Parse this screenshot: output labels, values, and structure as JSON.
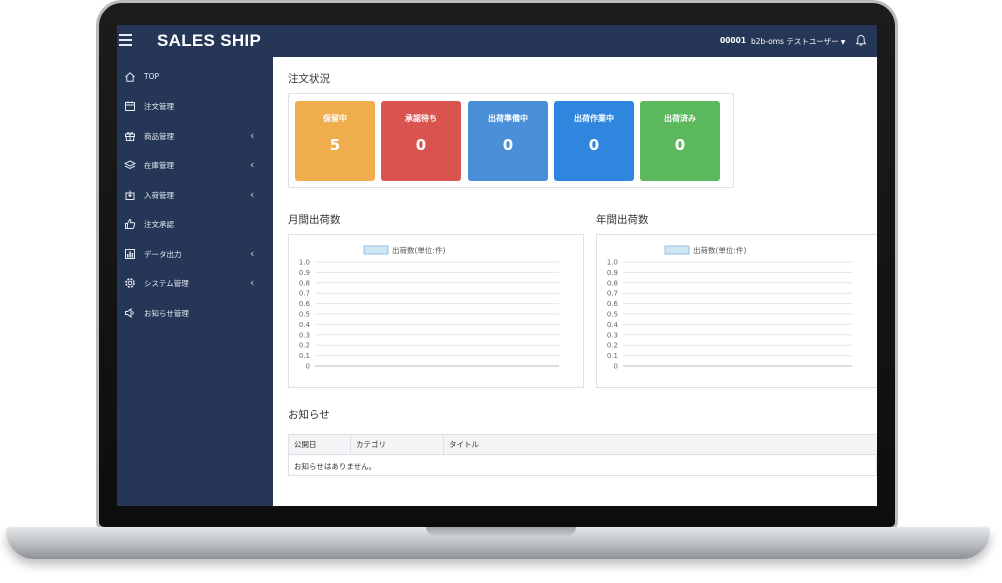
{
  "app": {
    "title": "SALES SHIP"
  },
  "header": {
    "user_code": "00001",
    "user_name": "b2b-oms テストユーザー",
    "icons": [
      "hamburger-menu-icon",
      "bell-icon"
    ]
  },
  "sidebar": {
    "items": [
      {
        "label": "TOP",
        "icon": "home-icon",
        "expandable": false
      },
      {
        "label": "注文管理",
        "icon": "calendar-icon",
        "expandable": false
      },
      {
        "label": "商品管理",
        "icon": "gift-icon",
        "expandable": true
      },
      {
        "label": "在庫管理",
        "icon": "layers-icon",
        "expandable": true
      },
      {
        "label": "入荷管理",
        "icon": "download-box-icon",
        "expandable": true
      },
      {
        "label": "注文承認",
        "icon": "thumbs-up-icon",
        "expandable": false
      },
      {
        "label": "データ出力",
        "icon": "bar-chart-icon",
        "expandable": true
      },
      {
        "label": "システム管理",
        "icon": "gear-icon",
        "expandable": true
      },
      {
        "label": "お知らせ管理",
        "icon": "megaphone-icon",
        "expandable": false
      }
    ]
  },
  "order_status": {
    "title": "注文状況",
    "cards": [
      {
        "label": "保留中",
        "count": "5",
        "color": "#f0ad4e"
      },
      {
        "label": "承認待ち",
        "count": "0",
        "color": "#d9534f"
      },
      {
        "label": "出荷準備中",
        "count": "0",
        "color": "#4a90d9"
      },
      {
        "label": "出荷作業中",
        "count": "0",
        "color": "#2e86de"
      },
      {
        "label": "出荷済み",
        "count": "0",
        "color": "#5cb85c"
      }
    ]
  },
  "charts_titles": {
    "monthly": "月間出荷数",
    "yearly": "年間出荷数"
  },
  "chart_data": [
    {
      "type": "bar",
      "title": "",
      "legend": "出荷数(単位:件)",
      "legend_position": "top-center",
      "yticks": [
        "1.0",
        "0.9",
        "0.8",
        "0.7",
        "0.6",
        "0.5",
        "0.4",
        "0.3",
        "0.2",
        "0.1",
        "0"
      ],
      "ylim": [
        0,
        1.0
      ],
      "grid": true,
      "categories": [],
      "series": [
        {
          "name": "出荷数(単位:件)",
          "values": []
        }
      ]
    },
    {
      "type": "bar",
      "title": "",
      "legend": "出荷数(単位:件)",
      "legend_position": "top-center",
      "yticks": [
        "1.0",
        "0.9",
        "0.8",
        "0.7",
        "0.6",
        "0.5",
        "0.4",
        "0.3",
        "0.2",
        "0.1",
        "0"
      ],
      "ylim": [
        0,
        1.0
      ],
      "grid": true,
      "categories": [],
      "series": [
        {
          "name": "出荷数(単位:件)",
          "values": []
        }
      ]
    }
  ],
  "notices": {
    "title": "お知らせ",
    "columns": [
      "公開日",
      "カテゴリ",
      "タイトル"
    ],
    "empty_message": "お知らせはありません。"
  }
}
